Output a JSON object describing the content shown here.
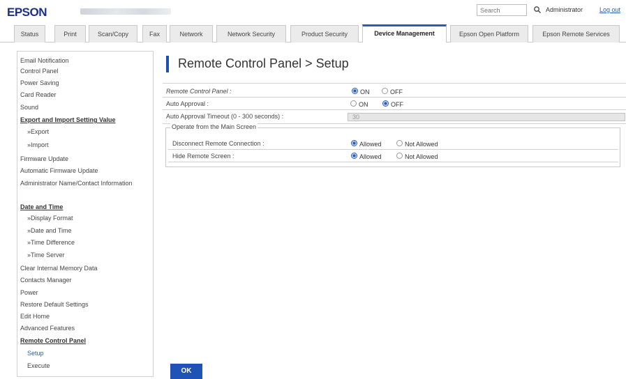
{
  "header": {
    "logo": "EPSON",
    "search_placeholder": "Search",
    "admin_label": "Administrator",
    "logout_label": "Log out"
  },
  "tabs": [
    {
      "label": "Status"
    },
    {
      "label": "Print"
    },
    {
      "label": "Scan/Copy"
    },
    {
      "label": "Fax"
    },
    {
      "label": "Network"
    },
    {
      "label": "Network Security"
    },
    {
      "label": "Product Security"
    },
    {
      "label": "Device Management",
      "active": true
    },
    {
      "label": "Epson Open Platform"
    },
    {
      "label": "Epson Remote Services"
    }
  ],
  "sidebar": {
    "items": [
      {
        "label": "Email Notification"
      },
      {
        "label": "Control Panel"
      },
      {
        "label": "Power Saving"
      },
      {
        "label": "Card Reader"
      },
      {
        "label": "Sound"
      },
      {
        "label": "Export and Import Setting Value"
      },
      {
        "label": "»Export"
      },
      {
        "label": "»Import"
      },
      {
        "label": "Firmware Update"
      },
      {
        "label": "Automatic Firmware Update"
      },
      {
        "label": "Administrator Name/Contact Information"
      },
      {
        "label": "Date and Time"
      },
      {
        "label": "»Display Format"
      },
      {
        "label": "»Date and Time"
      },
      {
        "label": "»Time Difference"
      },
      {
        "label": "»Time Server"
      },
      {
        "label": "Clear Internal Memory Data"
      },
      {
        "label": "Contacts Manager"
      },
      {
        "label": "Power"
      },
      {
        "label": "Restore Default Settings"
      },
      {
        "label": "Edit Home"
      },
      {
        "label": "Advanced Features"
      },
      {
        "label": "Remote Control Panel"
      },
      {
        "label": "Setup"
      },
      {
        "label": "Execute"
      }
    ]
  },
  "main": {
    "title": "Remote Control Panel > Setup",
    "remote_control_panel": {
      "label": "Remote Control Panel :",
      "on": "ON",
      "off": "OFF",
      "selected": "ON"
    },
    "auto_approval": {
      "label": "Auto Approval :",
      "on": "ON",
      "off": "OFF",
      "selected": "OFF"
    },
    "auto_approval_timeout": {
      "label": "Auto Approval Timeout (0 - 300 seconds) :",
      "value": "30"
    },
    "group": {
      "legend": "Operate from the Main Screen",
      "disconnect": {
        "label": "Disconnect Remote Connection :",
        "allowed": "Allowed",
        "not_allowed": "Not Allowed",
        "selected": "Allowed"
      },
      "hide_screen": {
        "label": "Hide Remote Screen :",
        "allowed": "Allowed",
        "not_allowed": "Not Allowed",
        "selected": "Allowed"
      }
    },
    "ok_label": "OK"
  },
  "colors": {
    "brand": "#1a2f8a",
    "accent": "#1f53b5",
    "link": "#2a5db0"
  }
}
